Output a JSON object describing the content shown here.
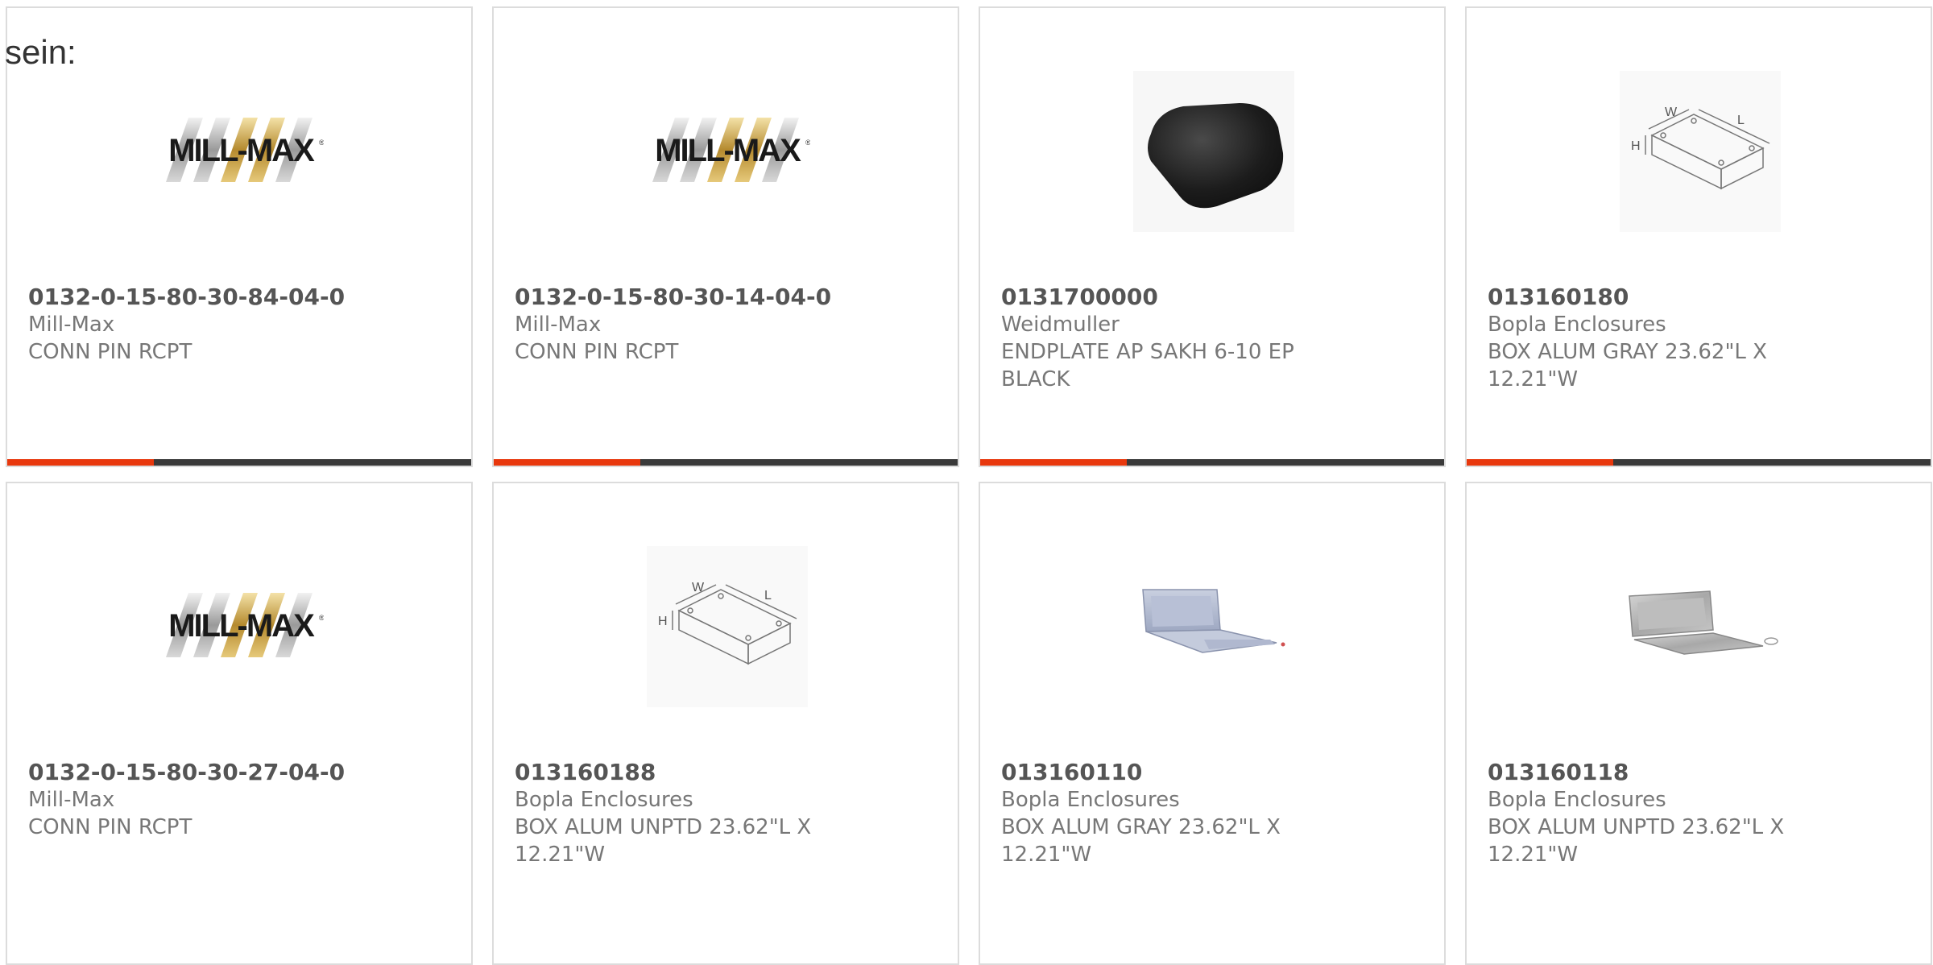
{
  "heading": "sein:",
  "accent_color": "#e8380d",
  "cards": [
    {
      "part_number": "0132-0-15-80-30-84-04-0",
      "manufacturer": "Mill-Max",
      "description": "CONN PIN RCPT",
      "image": "mill-max-logo"
    },
    {
      "part_number": "0132-0-15-80-30-14-04-0",
      "manufacturer": "Mill-Max",
      "description": "CONN PIN RCPT",
      "image": "mill-max-logo"
    },
    {
      "part_number": "0131700000",
      "manufacturer": "Weidmuller",
      "description": "ENDPLATE AP SAKH 6-10 EP BLACK",
      "image": "black-endplate-photo"
    },
    {
      "part_number": "013160180",
      "manufacturer": "Bopla Enclosures",
      "description": "BOX ALUM GRAY 23.62\"L X 12.21\"W",
      "image": "enclosure-dimension-drawing"
    },
    {
      "part_number": "0132-0-15-80-30-27-04-0",
      "manufacturer": "Mill-Max",
      "description": "CONN PIN RCPT",
      "image": "mill-max-logo"
    },
    {
      "part_number": "013160188",
      "manufacturer": "Bopla Enclosures",
      "description": "BOX ALUM UNPTD 23.62\"L X 12.21\"W",
      "image": "enclosure-dimension-drawing"
    },
    {
      "part_number": "013160110",
      "manufacturer": "Bopla Enclosures",
      "description": "BOX ALUM GRAY 23.62\"L X 12.21\"W",
      "image": "gray-box-open-photo"
    },
    {
      "part_number": "013160118",
      "manufacturer": "Bopla Enclosures",
      "description": "BOX ALUM UNPTD 23.62\"L X 12.21\"W",
      "image": "aluminum-box-open-photo"
    }
  ]
}
